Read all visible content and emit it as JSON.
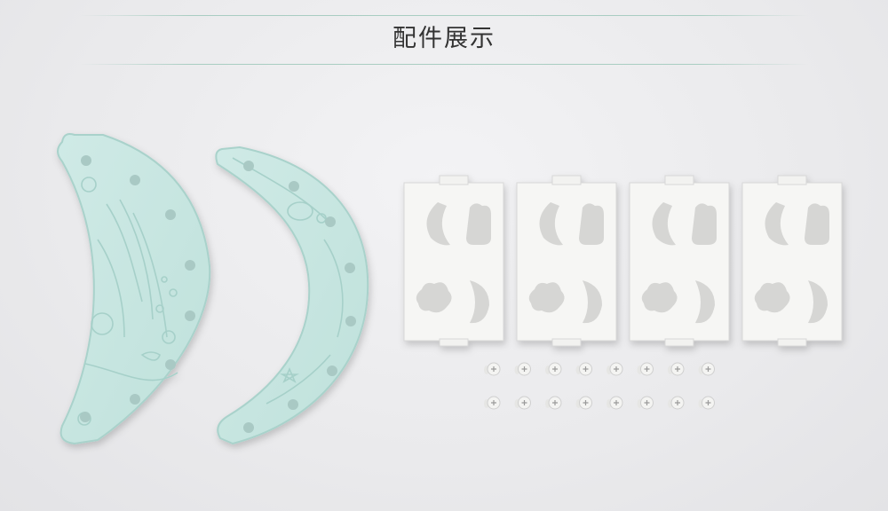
{
  "header": {
    "title": "配件展示"
  },
  "colors": {
    "arc_panel": "#c6e6e1",
    "connector": "#f6f6f4",
    "accent_line": "#a9cdc2"
  },
  "items": {
    "arc_panels": 2,
    "connector_blocks": 4,
    "screws": 16
  }
}
